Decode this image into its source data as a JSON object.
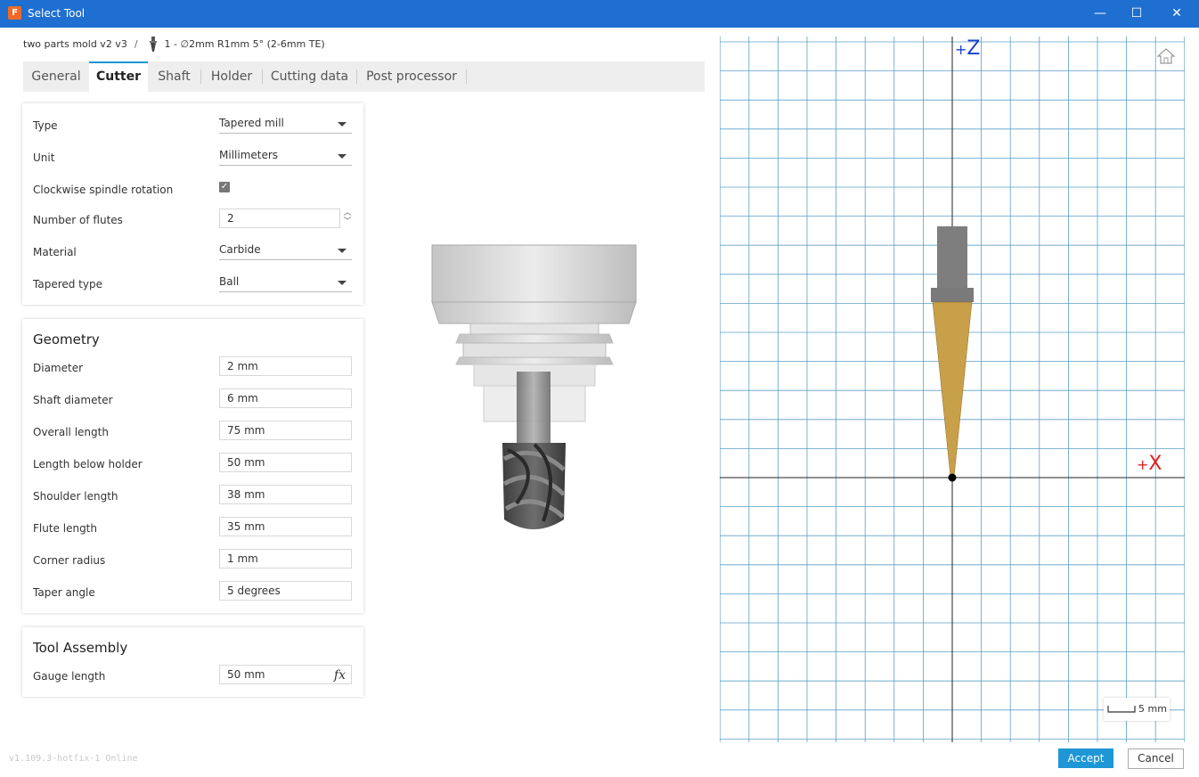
{
  "window": {
    "title": "Select Tool",
    "app_icon": "F"
  },
  "breadcrumb": {
    "project": "two parts mold v2 v3",
    "separator": "/",
    "tool": "1 - ∅2mm R1mm 5° (2-6mm TE)"
  },
  "tabs": [
    "General",
    "Cutter",
    "Shaft",
    "Holder",
    "Cutting data",
    "Post processor"
  ],
  "active_tab": "Cutter",
  "cutter": {
    "type_label": "Type",
    "type_value": "Tapered mill",
    "unit_label": "Unit",
    "unit_value": "Millimeters",
    "clockwise_label": "Clockwise spindle rotation",
    "clockwise_checked": true,
    "flutes_label": "Number of flutes",
    "flutes_value": "2",
    "material_label": "Material",
    "material_value": "Carbide",
    "tapered_type_label": "Tapered type",
    "tapered_type_value": "Ball"
  },
  "geometry": {
    "title": "Geometry",
    "rows": [
      {
        "label": "Diameter",
        "value": "2 mm"
      },
      {
        "label": "Shaft diameter",
        "value": "6 mm"
      },
      {
        "label": "Overall length",
        "value": "75 mm"
      },
      {
        "label": "Length below holder",
        "value": "50 mm"
      },
      {
        "label": "Shoulder length",
        "value": "38 mm"
      },
      {
        "label": "Flute length",
        "value": "35 mm"
      },
      {
        "label": "Corner radius",
        "value": "1 mm"
      },
      {
        "label": "Taper angle",
        "value": "5 degrees"
      }
    ]
  },
  "assembly": {
    "title": "Tool Assembly",
    "gauge_label": "Gauge length",
    "gauge_value": "50 mm",
    "fx_label": "fx"
  },
  "view": {
    "z_label": "Z",
    "x_label": "X",
    "plus": "+",
    "scale_label": "5 mm",
    "z_color": "#1a3fd0",
    "x_color": "#e02020"
  },
  "footer": {
    "version": "v1.109.3-hotfix-1 Online",
    "accept": "Accept",
    "cancel": "Cancel"
  },
  "colors": {
    "titlebar": "#1f6fd0",
    "accent": "#1f96d5",
    "taper": "#c9a04a"
  }
}
